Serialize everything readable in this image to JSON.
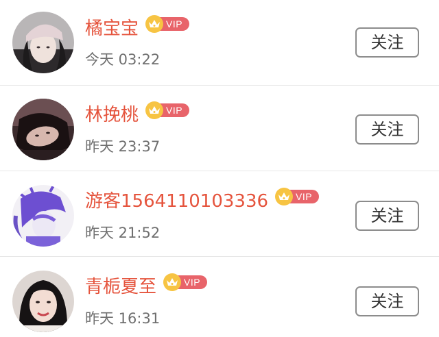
{
  "follow_list": [
    {
      "name": "橘宝宝",
      "vip_label": "VIP",
      "time": "今天 03:22",
      "follow_label": "关注"
    },
    {
      "name": "林挽桃",
      "vip_label": "VIP",
      "time": "昨天 23:37",
      "follow_label": "关注"
    },
    {
      "name": "游客1564110103336",
      "vip_label": "VIP",
      "time": "昨天 21:52",
      "follow_label": "关注"
    },
    {
      "name": "青栀夏至",
      "vip_label": "VIP",
      "time": "昨天 16:31",
      "follow_label": "关注"
    }
  ],
  "colors": {
    "name": "#e5543d",
    "vip_badge": "#e8646a",
    "vip_crown": "#f7c443",
    "time": "#6f6f6f",
    "divider": "#e6e6e6"
  }
}
